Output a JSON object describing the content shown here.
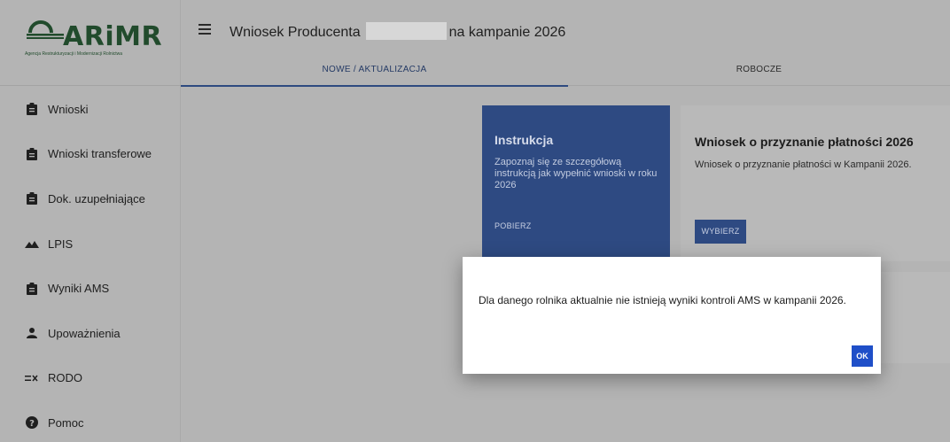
{
  "logo": {
    "name": "ARiMR",
    "subtitle": "Agencja Restrukturyzacji i Modernizacji Rolnictwa"
  },
  "sidebar": {
    "items": [
      {
        "label": "Wnioski",
        "icon": "clipboard-icon"
      },
      {
        "label": "Wnioski transferowe",
        "icon": "clipboard-icon"
      },
      {
        "label": "Dok. uzupełniające",
        "icon": "clipboard-icon"
      },
      {
        "label": "LPIS",
        "icon": "terrain-icon"
      },
      {
        "label": "Wyniki AMS",
        "icon": "clipboard-icon"
      },
      {
        "label": "Upoważnienia",
        "icon": "person-icon"
      },
      {
        "label": "RODO",
        "icon": "rule-icon"
      },
      {
        "label": "Pomoc",
        "icon": "help-icon"
      }
    ]
  },
  "header": {
    "title_prefix": "Wniosek Producenta",
    "title_suffix": "na kampanie 2026",
    "tabs": [
      {
        "label": "NOWE / AKTUALIZACJA"
      },
      {
        "label": "ROBOCZE"
      }
    ]
  },
  "cards": {
    "instruction": {
      "title": "Instrukcja",
      "description": "Zapoznaj się ze szczegółową instrukcją jak wypełnić wnioski w roku 2026",
      "button": "POBIERZ"
    },
    "application": {
      "title": "Wniosek o przyznanie płatności 2026",
      "description": "Wniosek o przyznanie płatności w Kampanii 2026.",
      "button": "WYBIERZ"
    }
  },
  "modal": {
    "message": "Dla danego rolnika aktualnie nie istnieją wyniki kontroli AMS w kampanii 2026.",
    "ok_label": "OK"
  },
  "colors": {
    "primary": "#2e4a82",
    "ok_button": "#1f4fc8",
    "backdrop": "#b4b4b4"
  }
}
